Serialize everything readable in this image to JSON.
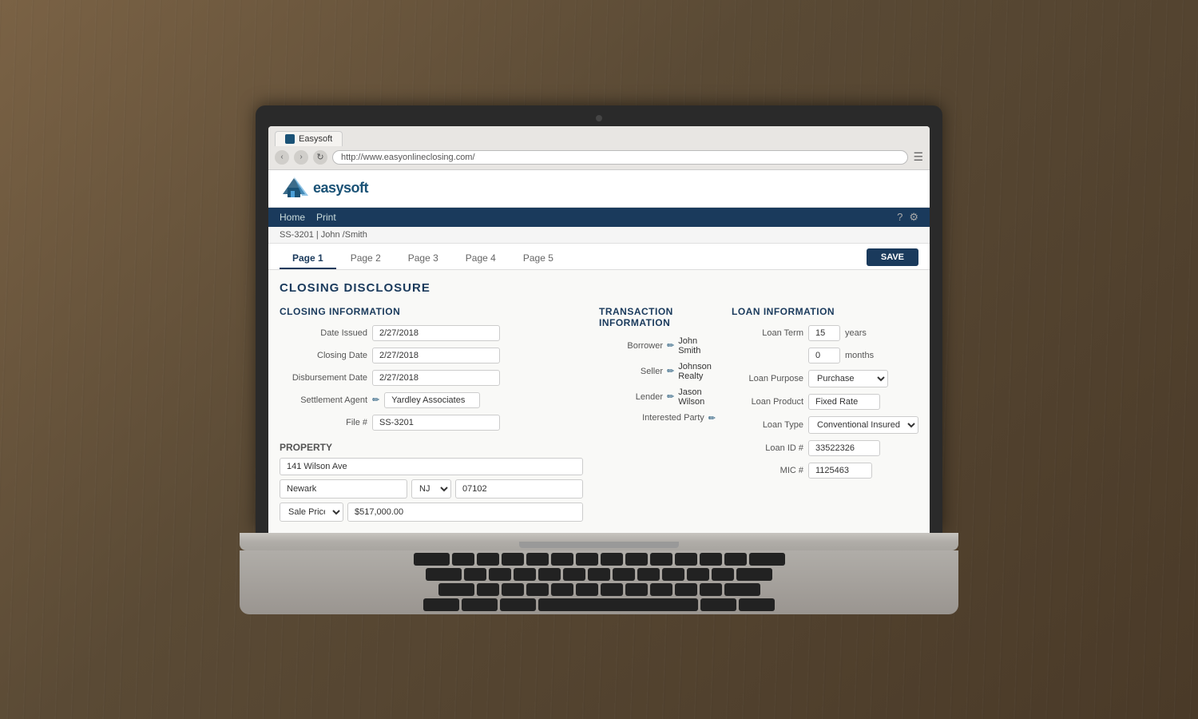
{
  "browser": {
    "tab_label": "Easysoft",
    "url": "http://www.easyonlineclosing.com/",
    "nav_back": "‹",
    "nav_fwd": "›",
    "reload": "↻",
    "menu_icon": "☰"
  },
  "app": {
    "logo_text": "easysoft",
    "nav_links": [
      "Home",
      "Print"
    ],
    "nav_right": [
      "?",
      "⚙"
    ],
    "breadcrumb": "SS-3201 | John /Smith",
    "page_title": "CLOSING DISCLOSURE",
    "save_button": "SAVE"
  },
  "tabs": [
    {
      "label": "Page 1",
      "active": true
    },
    {
      "label": "Page 2",
      "active": false
    },
    {
      "label": "Page 3",
      "active": false
    },
    {
      "label": "Page 4",
      "active": false
    },
    {
      "label": "Page 5",
      "active": false
    }
  ],
  "closing_information": {
    "section_title": "CLOSING INFORMATION",
    "fields": [
      {
        "label": "Date Issued",
        "value": "2/27/2018"
      },
      {
        "label": "Closing Date",
        "value": "2/27/2018"
      },
      {
        "label": "Disbursement Date",
        "value": "2/27/2018"
      },
      {
        "label": "Settlement Agent",
        "value": "Yardley Associates",
        "edit": true
      },
      {
        "label": "File #",
        "value": "SS-3201"
      }
    ]
  },
  "property": {
    "section_title": "PROPERTY",
    "address": "141 Wilson Ave",
    "city": "Newark",
    "state": "NJ",
    "zip": "07102",
    "sale_price_type": "Sale Price",
    "sale_price": "$517,000.00"
  },
  "transaction_information": {
    "section_title": "TRANSACTION INFORMATION",
    "borrower_label": "Borrower",
    "borrower_value": "John Smith",
    "seller_label": "Seller",
    "seller_value": "Johnson Realty",
    "lender_label": "Lender",
    "lender_value": "Jason Wilson",
    "interested_party_label": "Interested Party"
  },
  "loan_information": {
    "section_title": "LOAN INFORMATION",
    "loan_term_label": "Loan Term",
    "loan_term_years": "15",
    "loan_term_years_unit": "years",
    "loan_term_months": "0",
    "loan_term_months_unit": "months",
    "loan_purpose_label": "Loan Purpose",
    "loan_purpose_value": "Purchase",
    "loan_product_label": "Loan Product",
    "loan_product_value": "Fixed Rate",
    "loan_type_label": "Loan Type",
    "loan_type_value": "Conventional Insured",
    "loan_id_label": "Loan ID #",
    "loan_id_value": "33522326",
    "mic_label": "MIC #",
    "mic_value": "1125463"
  }
}
